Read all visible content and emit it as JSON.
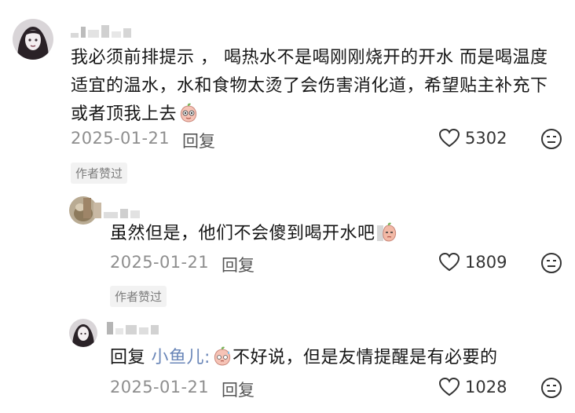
{
  "comments": [
    {
      "text": "我必须前排提示 ， 喝热水不是喝刚刚烧开的开水 而是喝温度适宜的温水，水和食物太烫了会伤害消化道，希望贴主补充下或者顶我上去",
      "lines": [
        "我必须前排提示 ， 喝热水不是喝刚刚烧开的开水 而是喝温度",
        "适宜的温水，水和食物太烫了会伤害消化道，希望贴主补充下",
        "或者顶我上去"
      ],
      "date": "2025-01-21",
      "reply_label": "回复",
      "likes": "5302",
      "author_liked": "作者赞过"
    },
    {
      "text": "虽然但是，他们不会傻到喝开水吧",
      "date": "2025-01-21",
      "reply_label": "回复",
      "likes": "1809",
      "author_liked": "作者赞过"
    },
    {
      "reply_prefix": "回复",
      "mention": "小鱼儿:",
      "text_after": "不好说，但是友情提醒是有必要的",
      "date": "2025-01-21",
      "reply_label": "回复",
      "likes": "1028"
    }
  ],
  "colors": {
    "date": "#8e8e8e",
    "mention": "#6a86b8",
    "badge_bg": "#f2f2f2"
  },
  "icons": [
    "heart-outline-icon",
    "face-emoji-icon",
    "peach-emoji-icon",
    "sweat-emoji-icon"
  ]
}
